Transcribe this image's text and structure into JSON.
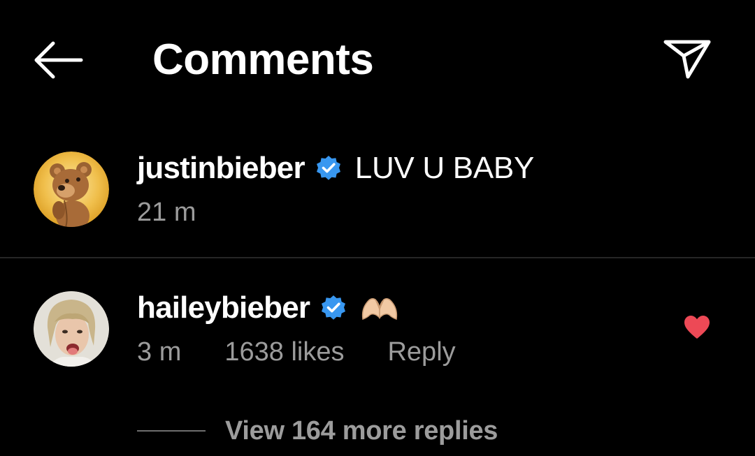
{
  "header": {
    "title": "Comments",
    "back_icon": "arrow-left-icon",
    "send_icon": "paper-plane-icon"
  },
  "comments": [
    {
      "username": "justinbieber",
      "verified": true,
      "text": "LUV U BABY",
      "time": "21 m",
      "avatar": "teddy-bear-avatar"
    },
    {
      "username": "haileybieber",
      "verified": true,
      "text": "",
      "emoji": "heart-hands-emoji",
      "time": "3 m",
      "likes": "1638 likes",
      "reply_label": "Reply",
      "liked": true,
      "avatar": "child-photo-avatar"
    }
  ],
  "view_replies": {
    "label": "View 164 more replies"
  },
  "colors": {
    "background": "#000000",
    "text": "#ffffff",
    "secondary_text": "#9c9c9c",
    "verified_blue": "#3897f0",
    "like_red": "#ed4956",
    "divider": "#262626"
  }
}
